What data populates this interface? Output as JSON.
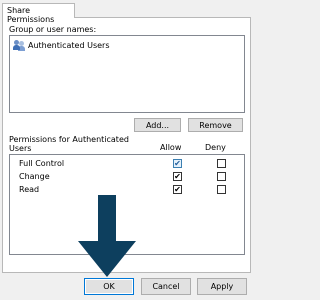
{
  "tab": {
    "label": "Share Permissions"
  },
  "group_section": {
    "label": "Group or user names:",
    "users": [
      {
        "label": "Authenticated Users",
        "icon": "users-group-icon"
      }
    ]
  },
  "buttons": {
    "add": "Add...",
    "remove": "Remove"
  },
  "permissions_section": {
    "label": "Permissions for Authenticated Users",
    "col_allow": "Allow",
    "col_deny": "Deny",
    "rows": [
      {
        "name": "Full Control",
        "allow": true,
        "deny": false
      },
      {
        "name": "Change",
        "allow": true,
        "deny": false
      },
      {
        "name": "Read",
        "allow": true,
        "deny": false
      }
    ]
  },
  "footer": {
    "ok": "OK",
    "cancel": "Cancel",
    "apply": "Apply"
  },
  "annotation": {
    "icon": "arrow-down-icon",
    "color": "#0d3f5e"
  }
}
